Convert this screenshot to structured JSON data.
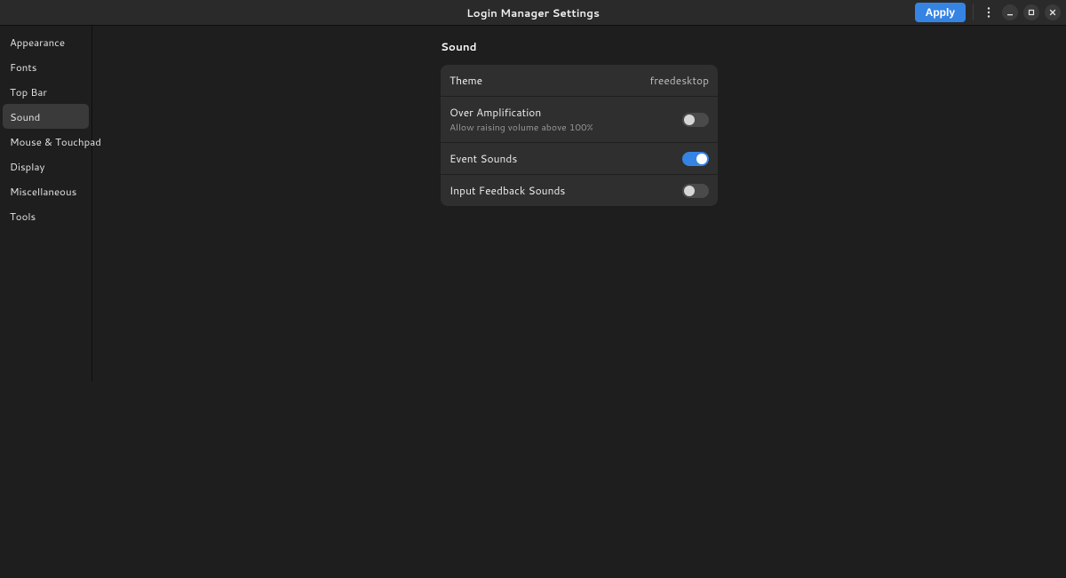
{
  "header": {
    "title": "Login Manager Settings",
    "apply_label": "Apply"
  },
  "sidebar": {
    "items": [
      {
        "label": "Appearance"
      },
      {
        "label": "Fonts"
      },
      {
        "label": "Top Bar"
      },
      {
        "label": "Sound"
      },
      {
        "label": "Mouse & Touchpad"
      },
      {
        "label": "Display"
      },
      {
        "label": "Miscellaneous"
      },
      {
        "label": "Tools"
      }
    ],
    "selected_index": 3
  },
  "panel": {
    "title": "Sound",
    "rows": {
      "theme": {
        "label": "Theme",
        "value": "freedesktop"
      },
      "over_amp": {
        "label": "Over Amplification",
        "sublabel": "Allow raising volume above 100%",
        "on": false
      },
      "event_sounds": {
        "label": "Event Sounds",
        "on": true
      },
      "input_feedback": {
        "label": "Input Feedback Sounds",
        "on": false
      }
    }
  }
}
